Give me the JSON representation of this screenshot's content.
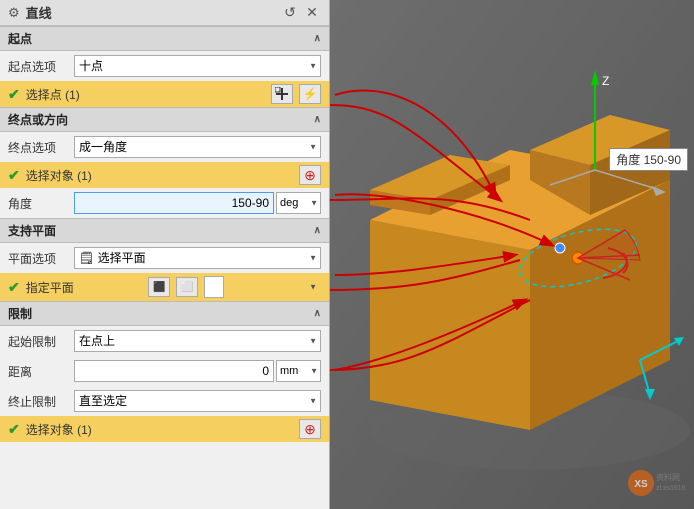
{
  "panel": {
    "title": "直线",
    "title_icon": "⚙",
    "reset_label": "↺",
    "close_label": "✕"
  },
  "sections": {
    "start_point": {
      "label": "起点",
      "start_option_label": "起点选项",
      "start_option_value": "十点",
      "selected_point_label": "选择点 (1)",
      "add_icon": "+",
      "pick_icon": "⚡"
    },
    "end_direction": {
      "label": "终点或方向",
      "end_option_label": "终点选项",
      "end_option_value": "成一角度",
      "selected_object_label": "选择对象 (1)",
      "angle_label": "角度",
      "angle_value": "150-90",
      "angle_unit": "deg"
    },
    "support_plane": {
      "label": "支持平面",
      "plane_option_label": "平面选项",
      "plane_option_value": "选择平面",
      "specify_plane_label": "指定平面"
    },
    "limits": {
      "label": "限制",
      "start_limit_label": "起始限制",
      "start_limit_value": "在点上",
      "distance_label": "距离",
      "distance_value": "0",
      "distance_unit": "mm",
      "end_limit_label": "终止限制",
      "end_limit_value": "直至选定",
      "selected_object_label": "选择对象 (1)"
    }
  },
  "viewport": {
    "angle_tooltip": "角度 150-90"
  },
  "watermark": {
    "text": "zl.xs1616.com",
    "logo": "XS"
  }
}
